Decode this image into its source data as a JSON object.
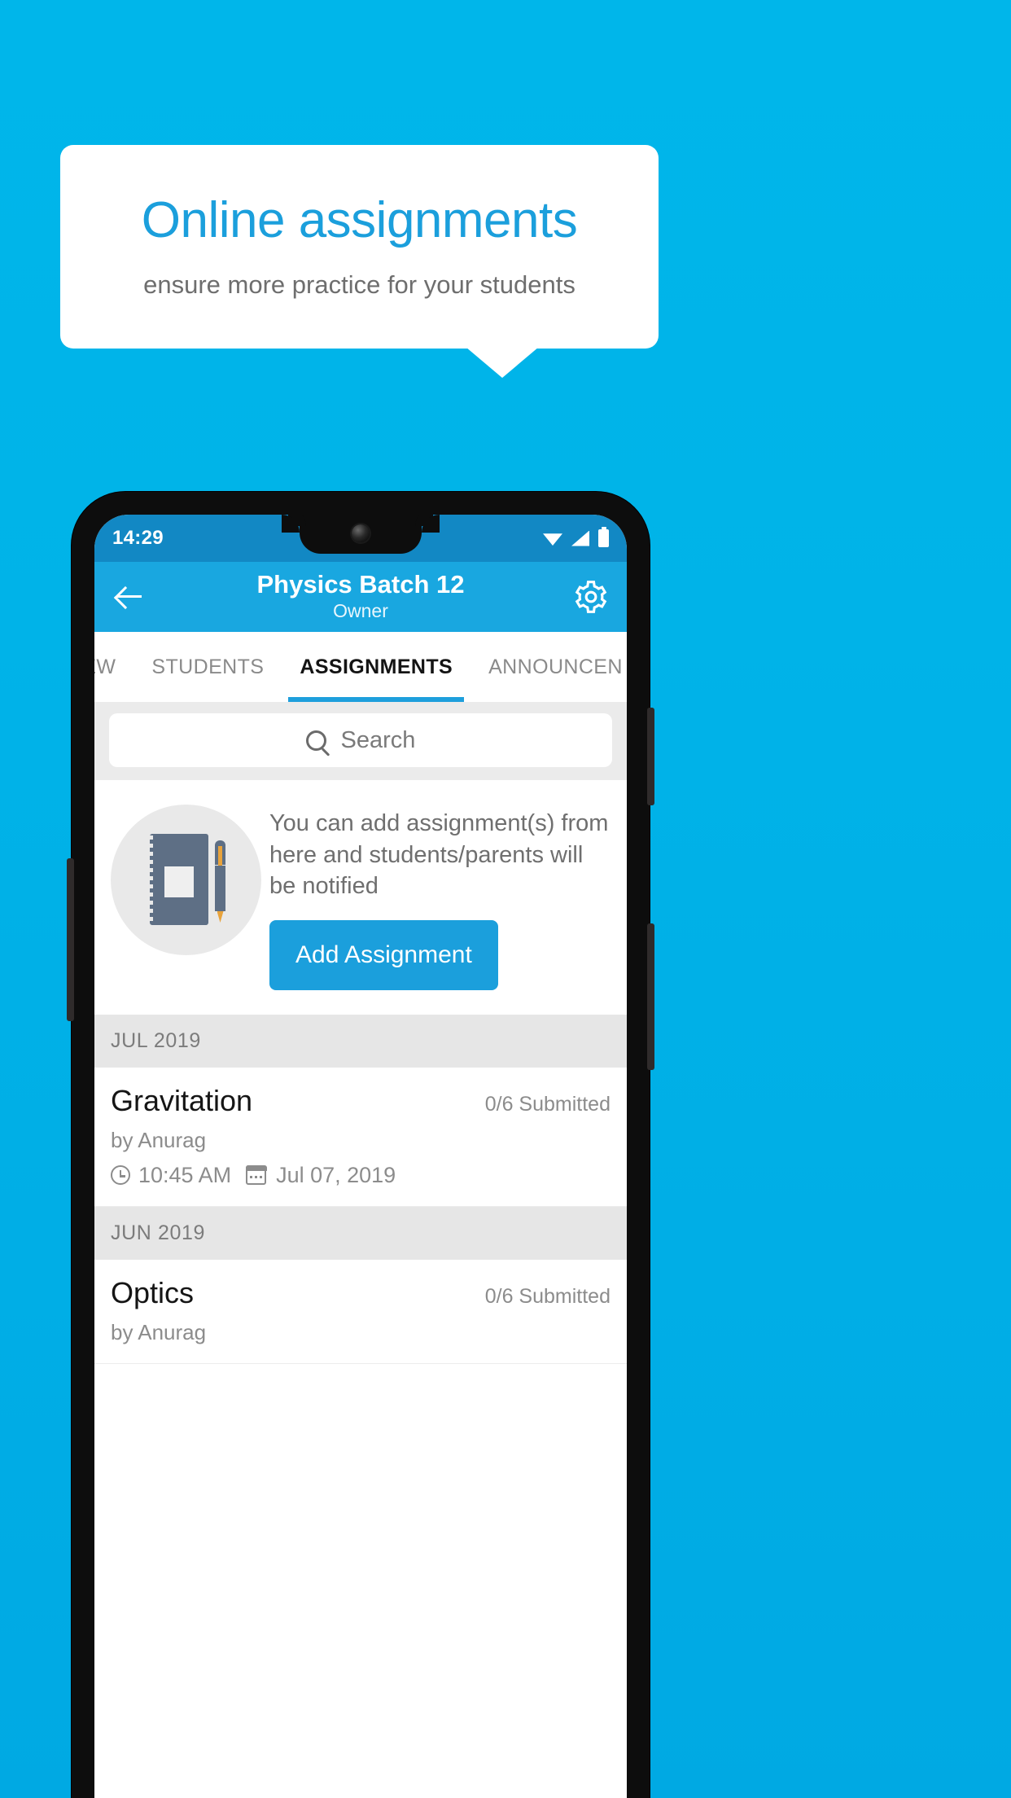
{
  "promo": {
    "title": "Online assignments",
    "subtitle": "ensure more practice for your students",
    "title_color": "#1B9FDC",
    "background_color": "#00B3E8"
  },
  "phone": {
    "status_bar": {
      "time": "14:29",
      "icons": [
        "wifi-icon",
        "signal-icon",
        "battery-icon"
      ],
      "background_color": "#1288C4"
    },
    "app_bar": {
      "back_icon": "back-arrow-icon",
      "title": "Physics Batch 12",
      "subtitle": "Owner",
      "settings_icon": "gear-icon",
      "background_color": "#19A7E0"
    },
    "tabs": [
      {
        "label": "IEW",
        "active": false
      },
      {
        "label": "STUDENTS",
        "active": false
      },
      {
        "label": "ASSIGNMENTS",
        "active": true
      },
      {
        "label": "ANNOUNCEN",
        "active": false
      }
    ],
    "search": {
      "icon": "search-icon",
      "placeholder": "Search",
      "value": ""
    },
    "empty_state": {
      "illustration": "notebook-and-pen-icon",
      "message": "You can add assignment(s) from here and students/parents will be notified",
      "button_label": "Add Assignment",
      "button_color": "#1B9FDC"
    },
    "sections": [
      {
        "month": "JUL 2019",
        "assignments": [
          {
            "title": "Gravitation",
            "submitted": "0/6 Submitted",
            "author": "by Anurag",
            "time": "10:45 AM",
            "date": "Jul 07, 2019"
          }
        ]
      },
      {
        "month": "JUN 2019",
        "assignments": [
          {
            "title": "Optics",
            "submitted": "0/6 Submitted",
            "author": "by Anurag",
            "time": "",
            "date": ""
          }
        ]
      }
    ]
  }
}
